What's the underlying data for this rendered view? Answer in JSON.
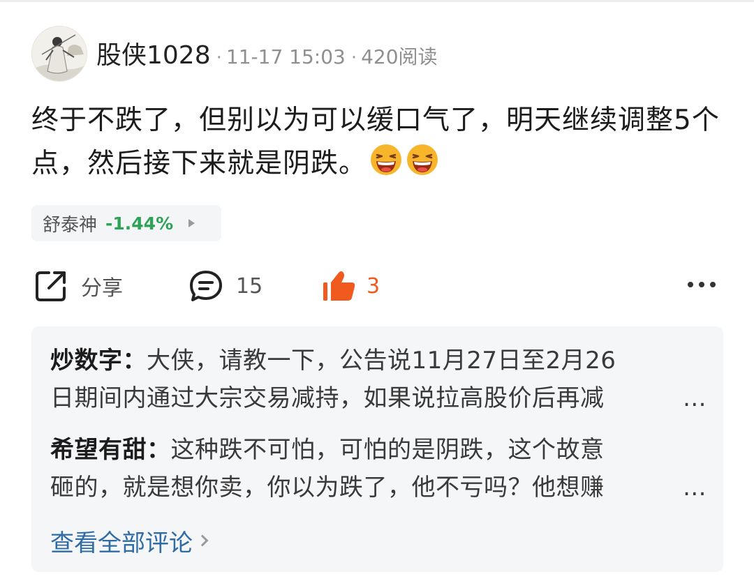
{
  "post": {
    "author": "股侠1028",
    "separator": "·",
    "date": "11-17 15:03",
    "reads": "420阅读",
    "text": "终于不跌了，但别以为可以缓口气了，明天继续调整5个点，然后接下来就是阴跌。",
    "emojis": [
      "laughing-face-icon",
      "laughing-face-icon"
    ]
  },
  "stock": {
    "name": "舒泰神",
    "change": "-1.44%"
  },
  "actions": {
    "share_label": "分享",
    "comment_count": "15",
    "like_count": "3",
    "like_color": "#f05a1e"
  },
  "comments": [
    {
      "author": "炒数字：",
      "line1": "大侠，请教一下，公告说11月27日至2月26",
      "line2": "日期间内通过大宗交易减持，如果说拉高股价后再减"
    },
    {
      "author": "希望有甜：",
      "line1": "这种跌不可怕，可怕的是阴跌，这个故意",
      "line2": "砸的，就是想你卖，你以为跌了，他不亏吗？他想赚"
    }
  ],
  "ellipsis": "...",
  "view_all_label": "查看全部评论",
  "colors": {
    "stock_down": "#2ea357",
    "link": "#2f6ca6",
    "comment_bg": "#f5f6f8"
  }
}
